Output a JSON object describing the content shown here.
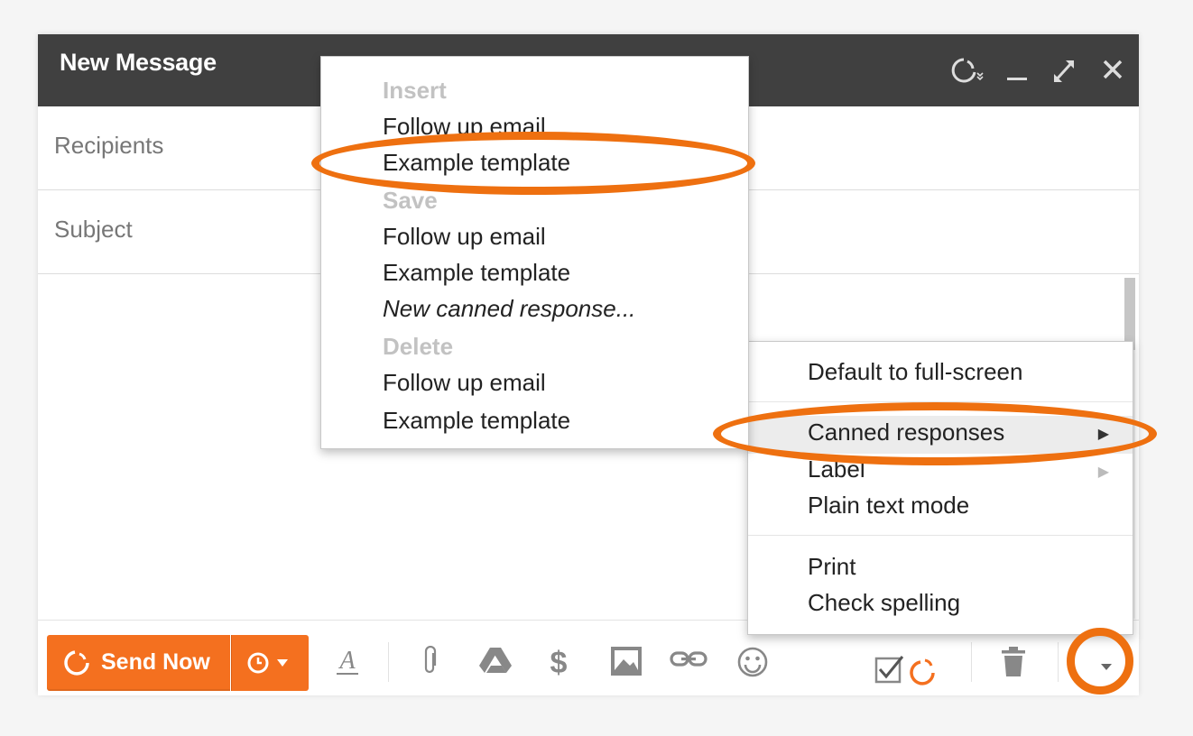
{
  "compose": {
    "title": "New Message",
    "recipients_placeholder": "Recipients",
    "subject_placeholder": "Subject"
  },
  "toolbar": {
    "send_label": "Send Now"
  },
  "canned_menu": {
    "insert_header": "Insert",
    "insert_items": [
      "Follow up email",
      "Example template"
    ],
    "save_header": "Save",
    "save_items": [
      "Follow up email",
      "Example template"
    ],
    "save_new": "New canned response...",
    "delete_header": "Delete",
    "delete_items": [
      "Follow up email",
      "Example template"
    ]
  },
  "more_menu": {
    "items": [
      "Default to full-screen",
      "Canned responses",
      "Label",
      "Plain text mode",
      "Print",
      "Check spelling"
    ],
    "submenu_arrow": "▶"
  },
  "colors": {
    "accent": "#f4701f",
    "highlight_ring": "#ee7010",
    "titlebar": "#404040"
  },
  "icons": [
    "streak-icon",
    "minimize-icon",
    "expand-icon",
    "close-icon",
    "clock-icon",
    "formatting-icon",
    "attach-icon",
    "drive-icon",
    "dollar-icon",
    "photo-icon",
    "link-icon",
    "emoji-icon",
    "checkbox-icon",
    "trash-icon",
    "chevron-down-icon"
  ]
}
